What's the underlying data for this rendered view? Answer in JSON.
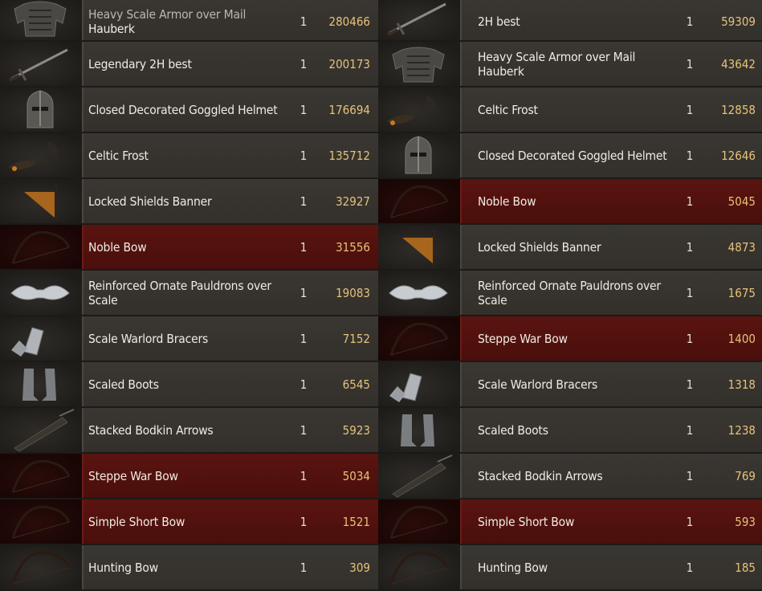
{
  "left_list": [
    {
      "name_line1": "Heavy Scale Armor over Mail",
      "name_line2": "Hauberk",
      "qty": "1",
      "value": "280466",
      "icon": "body-armor-icon",
      "style": "normal"
    },
    {
      "name_line1": "Legendary 2H best",
      "name_line2": "",
      "qty": "1",
      "value": "200173",
      "icon": "sword-icon",
      "style": "normal"
    },
    {
      "name_line1": "Closed Decorated Goggled Helmet",
      "name_line2": "",
      "qty": "1",
      "value": "176694",
      "icon": "helmet-icon",
      "style": "normal"
    },
    {
      "name_line1": "Celtic Frost",
      "name_line2": "",
      "qty": "1",
      "value": "135712",
      "icon": "horse-harness-icon",
      "style": "normal"
    },
    {
      "name_line1": "Locked Shields Banner",
      "name_line2": "",
      "qty": "1",
      "value": "32927",
      "icon": "banner-icon",
      "style": "normal"
    },
    {
      "name_line1": "Noble Bow",
      "name_line2": "",
      "qty": "1",
      "value": "31556",
      "icon": "bow-icon",
      "style": "red"
    },
    {
      "name_line1": "Reinforced Ornate Pauldrons over",
      "name_line2": "Scale",
      "qty": "1",
      "value": "19083",
      "icon": "pauldrons-icon",
      "style": "normal"
    },
    {
      "name_line1": "Scale Warlord Bracers",
      "name_line2": "",
      "qty": "1",
      "value": "7152",
      "icon": "bracers-icon",
      "style": "normal"
    },
    {
      "name_line1": "Scaled Boots",
      "name_line2": "",
      "qty": "1",
      "value": "6545",
      "icon": "boots-icon",
      "style": "normal"
    },
    {
      "name_line1": "Stacked Bodkin Arrows",
      "name_line2": "",
      "qty": "1",
      "value": "5923",
      "icon": "quiver-icon",
      "style": "normal"
    },
    {
      "name_line1": "Steppe War Bow",
      "name_line2": "",
      "qty": "1",
      "value": "5034",
      "icon": "bow-icon",
      "style": "red"
    },
    {
      "name_line1": "Simple Short Bow",
      "name_line2": "",
      "qty": "1",
      "value": "1521",
      "icon": "bow-icon",
      "style": "red"
    },
    {
      "name_line1": "Hunting Bow",
      "name_line2": "",
      "qty": "1",
      "value": "309",
      "icon": "bow-icon",
      "style": "normal"
    }
  ],
  "right_list": [
    {
      "name_line1": "2H best",
      "name_line2": "",
      "qty": "1",
      "value": "59309",
      "icon": "sword-icon",
      "style": "normal"
    },
    {
      "name_line1": "Heavy Scale Armor over Mail",
      "name_line2": "Hauberk",
      "qty": "1",
      "value": "43642",
      "icon": "body-armor-icon",
      "style": "normal"
    },
    {
      "name_line1": "Celtic Frost",
      "name_line2": "",
      "qty": "1",
      "value": "12858",
      "icon": "horse-harness-icon",
      "style": "normal"
    },
    {
      "name_line1": "Closed Decorated Goggled Helmet",
      "name_line2": "",
      "qty": "1",
      "value": "12646",
      "icon": "helmet-icon",
      "style": "normal"
    },
    {
      "name_line1": "Noble Bow",
      "name_line2": "",
      "qty": "1",
      "value": "5045",
      "icon": "bow-icon",
      "style": "red"
    },
    {
      "name_line1": "Locked Shields Banner",
      "name_line2": "",
      "qty": "1",
      "value": "4873",
      "icon": "banner-icon",
      "style": "normal"
    },
    {
      "name_line1": "Reinforced Ornate Pauldrons over",
      "name_line2": "Scale",
      "qty": "1",
      "value": "1675",
      "icon": "pauldrons-icon",
      "style": "normal"
    },
    {
      "name_line1": "Steppe War Bow",
      "name_line2": "",
      "qty": "1",
      "value": "1400",
      "icon": "bow-icon",
      "style": "red"
    },
    {
      "name_line1": "Scale Warlord Bracers",
      "name_line2": "",
      "qty": "1",
      "value": "1318",
      "icon": "bracers-icon",
      "style": "normal"
    },
    {
      "name_line1": "Scaled Boots",
      "name_line2": "",
      "qty": "1",
      "value": "1238",
      "icon": "boots-icon",
      "style": "normal"
    },
    {
      "name_line1": "Stacked Bodkin Arrows",
      "name_line2": "",
      "qty": "1",
      "value": "769",
      "icon": "quiver-icon",
      "style": "normal"
    },
    {
      "name_line1": "Simple Short Bow",
      "name_line2": "",
      "qty": "1",
      "value": "593",
      "icon": "bow-icon",
      "style": "red"
    },
    {
      "name_line1": "Hunting Bow",
      "name_line2": "",
      "qty": "1",
      "value": "185",
      "icon": "bow-icon",
      "style": "normal"
    }
  ],
  "colors": {
    "row_bg": "#3a3733",
    "row_red_bg": "#5a1410",
    "value_gold": "#e6c27a",
    "text": "#f0ebe2"
  }
}
